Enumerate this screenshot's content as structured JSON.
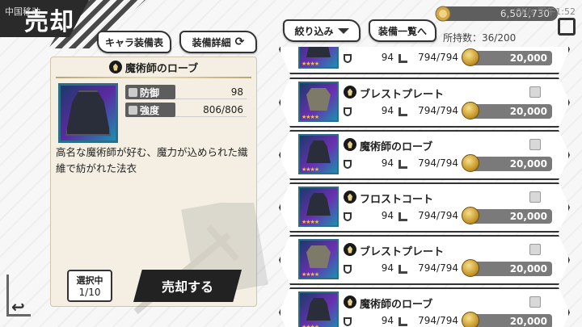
{
  "screen": {
    "title": "売却",
    "status_left": "中国移动",
    "status_right": "0K/s  下午1:52",
    "gold_amount": "6,501,730"
  },
  "toolbar": {
    "chara_equip_label": "キャラ装備表",
    "equip_detail_label": "装備詳細",
    "filter_label": "絞り込み",
    "equip_list_label": "装備一覧へ",
    "owned_label": "所持数：36/200"
  },
  "detail": {
    "item_name": "魔術師のローブ",
    "stats": [
      {
        "label": "防御",
        "value": "98"
      },
      {
        "label": "強度",
        "value": "806/806"
      }
    ],
    "description": "高名な魔術師が好む、魔力が込められた織維で紡がれた法衣",
    "selection_label": "選択中",
    "selection_count": "1/10",
    "sell_button": "売却する"
  },
  "items": [
    {
      "name": "",
      "defense": "94",
      "durability": "794/794",
      "price": "20,000",
      "kind": "robe",
      "stars": "★★★★"
    },
    {
      "name": "ブレストプレート",
      "defense": "94",
      "durability": "794/794",
      "price": "20,000",
      "kind": "armor",
      "stars": "★★★★"
    },
    {
      "name": "魔術師のローブ",
      "defense": "94",
      "durability": "794/794",
      "price": "20,000",
      "kind": "robe",
      "stars": "★★★★"
    },
    {
      "name": "フロストコート",
      "defense": "94",
      "durability": "794/794",
      "price": "20,000",
      "kind": "robe",
      "stars": "★★★★"
    },
    {
      "name": "ブレストプレート",
      "defense": "94",
      "durability": "794/794",
      "price": "20,000",
      "kind": "armor",
      "stars": "★★★★"
    },
    {
      "name": "魔術師のローブ",
      "defense": "94",
      "durability": "794/794",
      "price": "20,000",
      "kind": "robe",
      "stars": "★★★★"
    }
  ],
  "icons": {
    "back": "back-arrow-icon",
    "cycle": "cycle-icon",
    "filter": "triangle-down-icon",
    "coin": "gold-coin-icon",
    "defense": "shield-icon",
    "durability": "hammer-icon"
  },
  "colors": {
    "banner": "#2a2a2a",
    "panel": "#f4efe2",
    "frame": "#2b6e8a",
    "sell_button": "#222222",
    "price_bar": "#7a7a7a"
  }
}
